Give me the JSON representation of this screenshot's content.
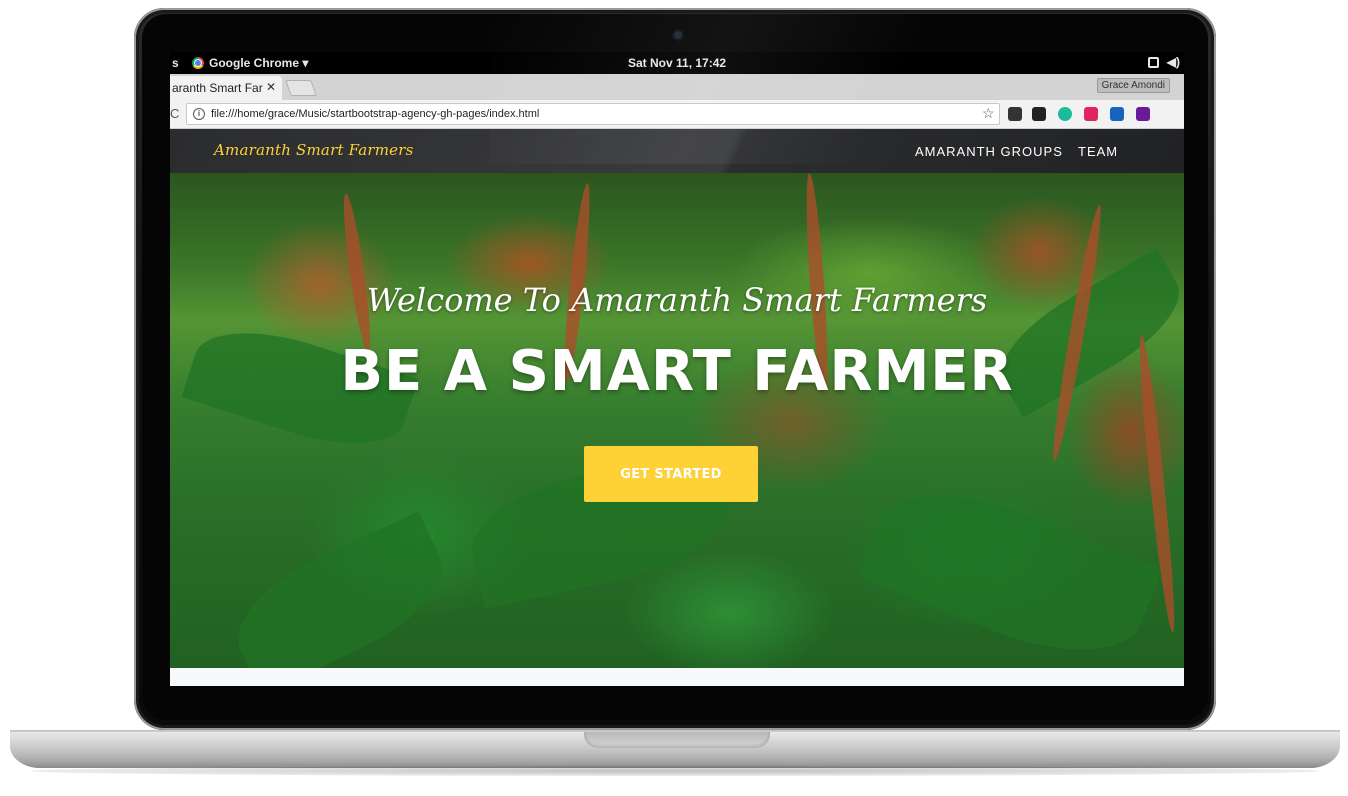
{
  "os_bar": {
    "activities_label": "s",
    "app_name": "Google Chrome ▾",
    "clock": "Sat Nov 11, 17:42",
    "tray_volume": "◀)"
  },
  "browser": {
    "tab_title": "aranth Smart Far",
    "tab_close": "✕",
    "profile_name": "Grace Amondi",
    "reload_glyph": "C",
    "address": "file:///home/grace/Music/startbootstrap-agency-gh-pages/index.html",
    "star_glyph": "☆",
    "info_glyph": "i",
    "extensions": [
      "extension-1",
      "extension-2",
      "extension-3",
      "extension-4",
      "extension-5",
      "extension-6"
    ],
    "extension_colors": [
      "#333333",
      "#222222",
      "#1abc9c",
      "#e0245e",
      "#1565c0",
      "#6a1b9a"
    ]
  },
  "site": {
    "brand": "Amaranth Smart Farmers",
    "nav": [
      {
        "label": "AMARANTH GROUPS"
      },
      {
        "label": "TEAM"
      }
    ],
    "hero": {
      "welcome": "Welcome To Amaranth Smart Farmers",
      "headline": "BE A SMART FARMER",
      "cta_label": "GET STARTED"
    },
    "colors": {
      "accent": "#fed136",
      "navbar": "#222222"
    }
  }
}
